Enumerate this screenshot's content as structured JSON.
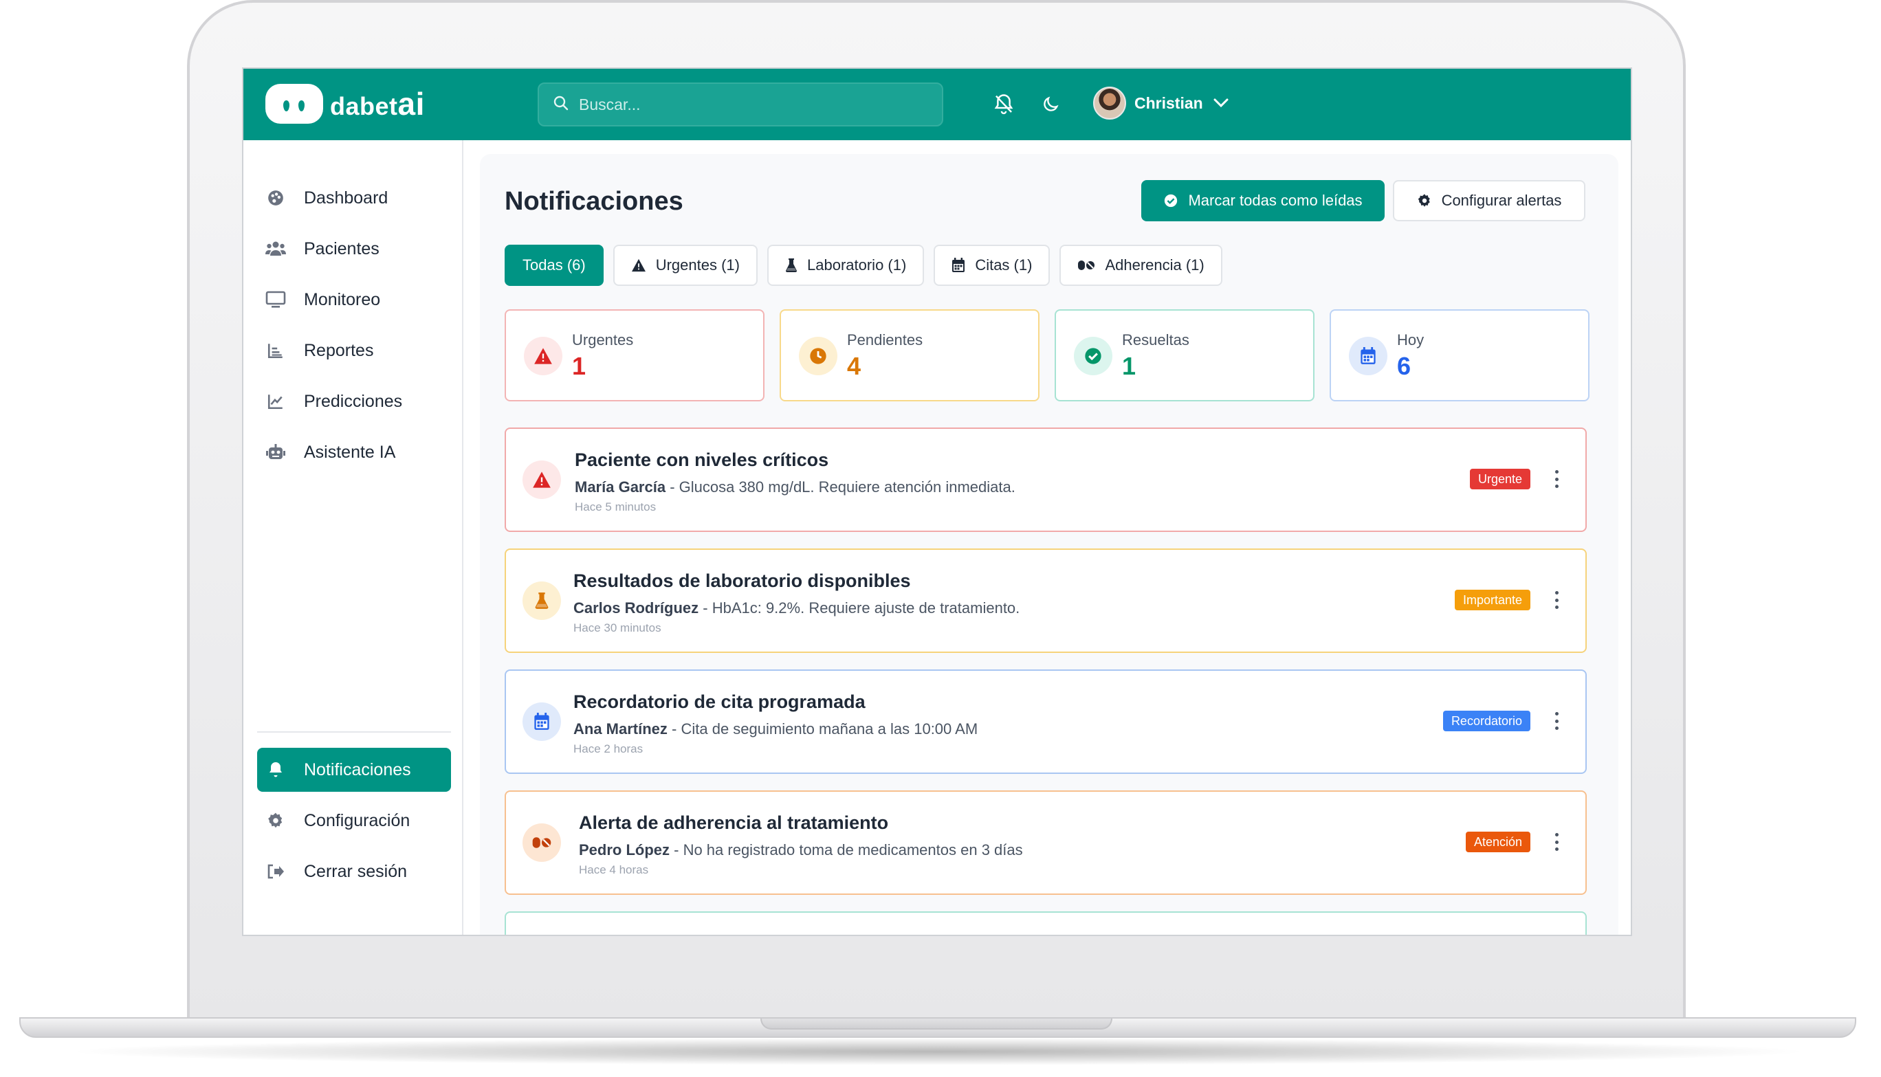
{
  "app": {
    "logo_text": "dabet",
    "logo_ai": "ai"
  },
  "search": {
    "placeholder": "Buscar..."
  },
  "user": {
    "name": "Christian"
  },
  "sidebar": {
    "items": [
      {
        "label": "Dashboard",
        "icon": "palette-icon"
      },
      {
        "label": "Pacientes",
        "icon": "users-icon"
      },
      {
        "label": "Monitoreo",
        "icon": "monitor-icon"
      },
      {
        "label": "Reportes",
        "icon": "bar-chart-icon"
      },
      {
        "label": "Predicciones",
        "icon": "line-chart-icon"
      },
      {
        "label": "Asistente IA",
        "icon": "robot-icon"
      }
    ],
    "bottom_items": [
      {
        "label": "Notificaciones",
        "icon": "bell-icon",
        "active": true
      },
      {
        "label": "Configuración",
        "icon": "gear-icon"
      },
      {
        "label": "Cerrar sesión",
        "icon": "logout-icon"
      }
    ]
  },
  "main": {
    "title": "Notificaciones",
    "mark_all_label": "Marcar todas como leídas",
    "configure_label": "Configurar alertas",
    "tabs": [
      {
        "label": "Todas (6)",
        "active": true
      },
      {
        "label": "Urgentes (1)",
        "icon": "warning-icon"
      },
      {
        "label": "Laboratorio (1)",
        "icon": "flask-icon"
      },
      {
        "label": "Citas (1)",
        "icon": "calendar-icon"
      },
      {
        "label": "Adherencia (1)",
        "icon": "pills-icon"
      }
    ],
    "stats": [
      {
        "label": "Urgentes",
        "value": "1",
        "color": "#dc2626",
        "border": "#f3b4b4",
        "bg": "#fde8e8"
      },
      {
        "label": "Pendientes",
        "value": "4",
        "color": "#d97706",
        "border": "#f8d98a",
        "bg": "#fdf0d2"
      },
      {
        "label": "Resueltas",
        "value": "1",
        "color": "#059669",
        "border": "#a7e3d3",
        "bg": "#dcf5ee"
      },
      {
        "label": "Hoy",
        "value": "6",
        "color": "#2563eb",
        "border": "#bcd3f5",
        "bg": "#e0eafb"
      }
    ],
    "notifications": [
      {
        "title": "Paciente con niveles críticos",
        "patient": "María García",
        "message": " - Glucosa 380 mg/dL. Requiere atención inmediata.",
        "time": "Hace 5 minutos",
        "badge": "Urgente",
        "badge_color": "#e53935",
        "border": "#f1a9a9",
        "icon": "warning-icon",
        "icon_bg": "#fde8e8",
        "icon_color": "#dc2626"
      },
      {
        "title": "Resultados de laboratorio disponibles",
        "patient": "Carlos Rodríguez",
        "message": " - HbA1c: 9.2%. Requiere ajuste de tratamiento.",
        "time": "Hace 30 minutos",
        "badge": "Importante",
        "badge_color": "#f59e0b",
        "border": "#f6d37b",
        "icon": "flask-icon",
        "icon_bg": "#fdf0d2",
        "icon_color": "#d97706"
      },
      {
        "title": "Recordatorio de cita programada",
        "patient": "Ana Martínez",
        "message": " - Cita de seguimiento mañana a las 10:00 AM",
        "time": "Hace 2 horas",
        "badge": "Recordatorio",
        "badge_color": "#3b82f6",
        "border": "#a9c6f2",
        "icon": "calendar-icon",
        "icon_bg": "#e0eafb",
        "icon_color": "#2563eb"
      },
      {
        "title": "Alerta de adherencia al tratamiento",
        "patient": "Pedro López",
        "message": " - No ha registrado toma de medicamentos en 3 días",
        "time": "Hace 4 horas",
        "badge": "Atención",
        "badge_color": "#ea580c",
        "border": "#f7c08f",
        "icon": "pills-icon",
        "icon_bg": "#fde6d3",
        "icon_color": "#c2410c"
      }
    ]
  }
}
